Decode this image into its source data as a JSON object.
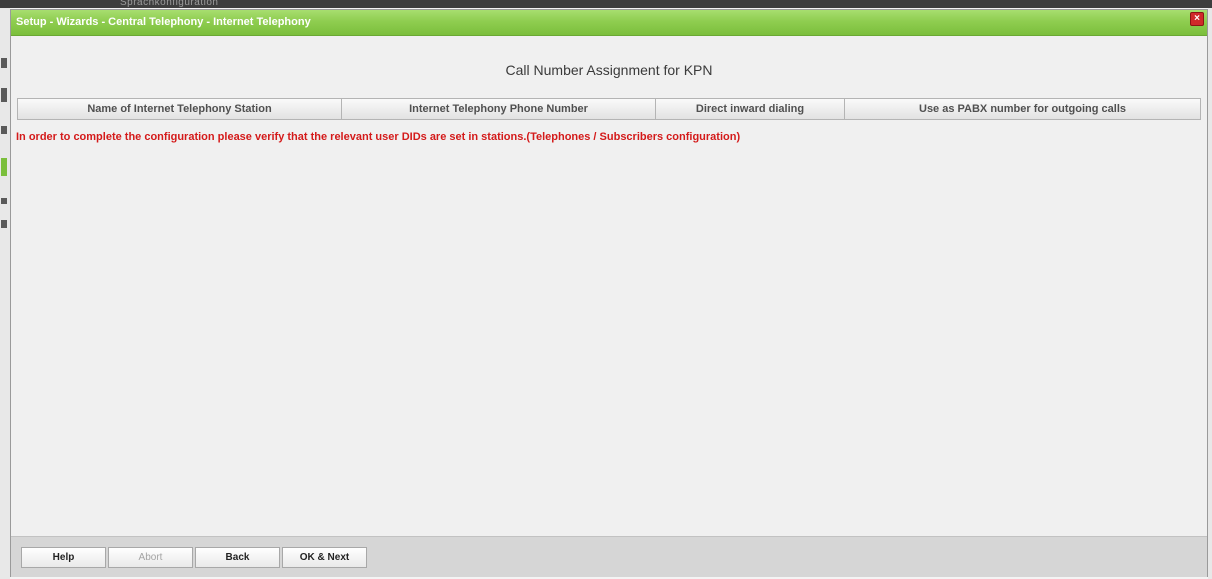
{
  "background": {
    "strip_text": "Sprachkonfiguration"
  },
  "dialog": {
    "title": "Setup - Wizards - Central Telephony - Internet Telephony",
    "close_symbol": "×",
    "heading": "Call Number Assignment for KPN",
    "columns": [
      "Name of Internet Telephony Station",
      "Internet Telephony Phone Number",
      "Direct inward dialing",
      "Use as PABX number for outgoing calls"
    ],
    "notice": "In order to complete the configuration please verify that the relevant user DIDs are set in stations.(Telephones / Subscribers configuration)"
  },
  "footer": {
    "buttons": [
      {
        "label": "Help",
        "enabled": true
      },
      {
        "label": "Abort",
        "enabled": false
      },
      {
        "label": "Back",
        "enabled": true
      },
      {
        "label": "OK & Next",
        "enabled": true
      }
    ]
  },
  "colors": {
    "titlebar_green": "#8fcd50",
    "notice_red": "#d41a1a",
    "close_red": "#d02a2a"
  }
}
